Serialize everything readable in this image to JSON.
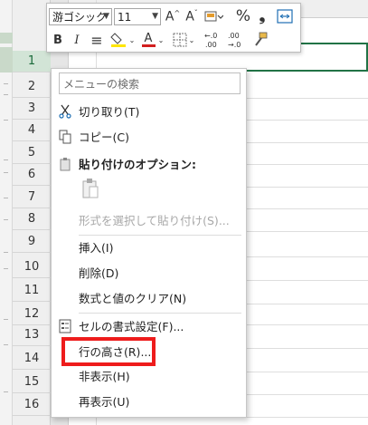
{
  "minitoolbar": {
    "font_name": "游ゴシック",
    "font_size": "11",
    "grow_font": "A^",
    "shrink_font": "Aˇ",
    "percent": "%",
    "comma": "9",
    "bold": "B",
    "italic": "I",
    "align": "≡",
    "font_color_letter": "A",
    "dec_inc": "⇐.0\n.00",
    "dec_dec": ".00\n⇒.0"
  },
  "context_menu": {
    "search_placeholder": "メニューの検索",
    "items": [
      {
        "label": "切り取り(T)",
        "icon": "scissors-icon",
        "disabled": false
      },
      {
        "label": "コピー(C)",
        "icon": "copy-icon",
        "disabled": false
      },
      {
        "label": "貼り付けのオプション:",
        "icon": "paste-options-icon",
        "disabled": false
      },
      {
        "label": "形式を選択して貼り付け(S)...",
        "icon": "",
        "disabled": true
      },
      {
        "label": "挿入(I)",
        "icon": "",
        "disabled": false
      },
      {
        "label": "削除(D)",
        "icon": "",
        "disabled": false
      },
      {
        "label": "数式と値のクリア(N)",
        "icon": "",
        "disabled": false
      },
      {
        "label": "セルの書式設定(F)...",
        "icon": "format-cells-icon",
        "disabled": false
      },
      {
        "label": "行の高さ(R)...",
        "icon": "",
        "disabled": false
      },
      {
        "label": "非表示(H)",
        "icon": "",
        "disabled": false
      },
      {
        "label": "再表示(U)",
        "icon": "",
        "disabled": false
      }
    ]
  },
  "row_headers": [
    "1",
    "2",
    "3",
    "4",
    "5",
    "6",
    "7",
    "8",
    "9",
    "10",
    "11",
    "12",
    "13",
    "14",
    "15",
    "16"
  ],
  "colors": {
    "highlight": "#ee1c1c",
    "excel_green": "#217346",
    "font_red": "#d21f1f",
    "fill_yellow": "#ffe600"
  }
}
